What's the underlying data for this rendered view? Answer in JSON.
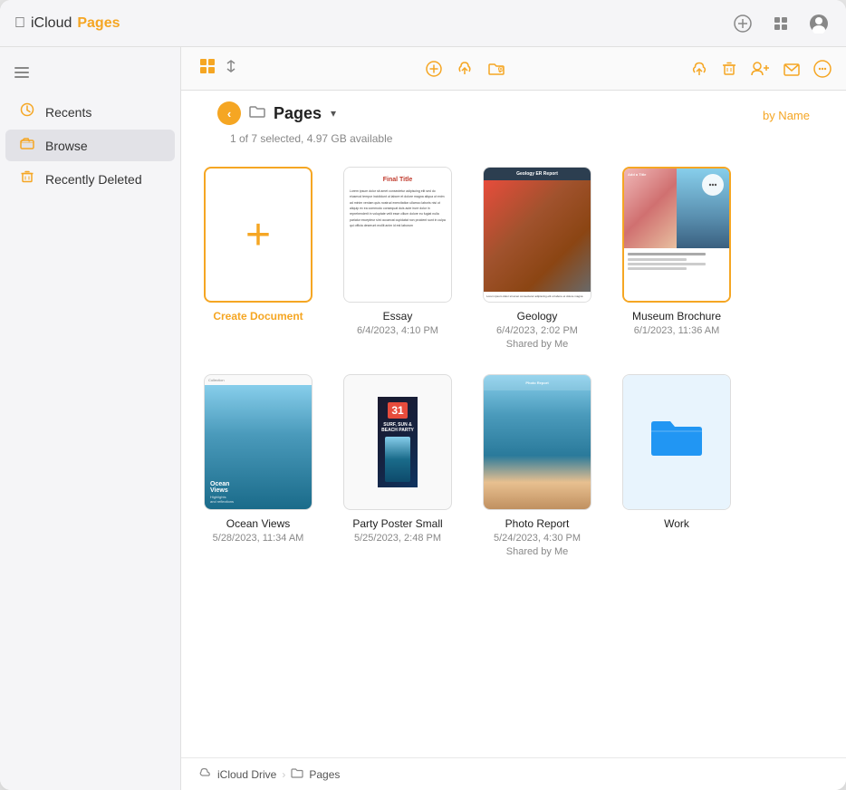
{
  "app": {
    "apple_logo": "",
    "icloud_label": "iCloud",
    "pages_label": "Pages"
  },
  "title_bar": {
    "add_button_label": "+",
    "grid_button_label": "⊞",
    "profile_button_label": "👤"
  },
  "sidebar": {
    "toggle_label": "⊟",
    "items": [
      {
        "id": "recents",
        "label": "Recents",
        "icon": "🕐"
      },
      {
        "id": "browse",
        "label": "Browse",
        "icon": "📁",
        "active": true
      },
      {
        "id": "recently-deleted",
        "label": "Recently Deleted",
        "icon": "🗑"
      }
    ]
  },
  "content_toolbar": {
    "view_grid_icon": "⊞",
    "view_list_icon": "↕",
    "add_icon": "+",
    "upload_icon": "☁",
    "folder_icon": "📁",
    "upload_cloud_icon": "☁",
    "delete_icon": "🗑",
    "share_icon": "👥",
    "email_icon": "✉",
    "more_icon": "⊖"
  },
  "folder_header": {
    "back_label": "‹",
    "folder_icon": "📁",
    "folder_name": "Pages",
    "chevron": "▾",
    "status": "1 of 7 selected, 4.97 GB available",
    "sort_label": "by Name"
  },
  "files": [
    {
      "id": "create-doc",
      "name": "Create Document",
      "type": "create",
      "date": "",
      "shared": false
    },
    {
      "id": "essay",
      "name": "Essay",
      "type": "document",
      "date": "6/4/2023, 4:10 PM",
      "shared": false
    },
    {
      "id": "geology",
      "name": "Geology",
      "type": "document",
      "date": "6/4/2023, 2:02 PM",
      "shared": true,
      "shared_label": "Shared by Me"
    },
    {
      "id": "museum-brochure",
      "name": "Museum Brochure",
      "type": "document",
      "date": "6/1/2023, 11:36 AM",
      "shared": false,
      "selected": true
    },
    {
      "id": "ocean-views",
      "name": "Ocean Views",
      "type": "document",
      "date": "5/28/2023, 11:34 AM",
      "shared": false
    },
    {
      "id": "party-poster",
      "name": "Party Poster Small",
      "type": "document",
      "date": "5/25/2023, 2:48 PM",
      "shared": false
    },
    {
      "id": "photo-report",
      "name": "Photo Report",
      "type": "document",
      "date": "5/24/2023, 4:30 PM",
      "shared": true,
      "shared_label": "Shared by Me"
    },
    {
      "id": "work",
      "name": "Work",
      "type": "folder",
      "date": "",
      "shared": false
    }
  ],
  "bottom_breadcrumb": {
    "icloud_icon": "☁",
    "icloud_label": "iCloud Drive",
    "separator": "›",
    "folder_icon": "📁",
    "pages_label": "Pages"
  }
}
